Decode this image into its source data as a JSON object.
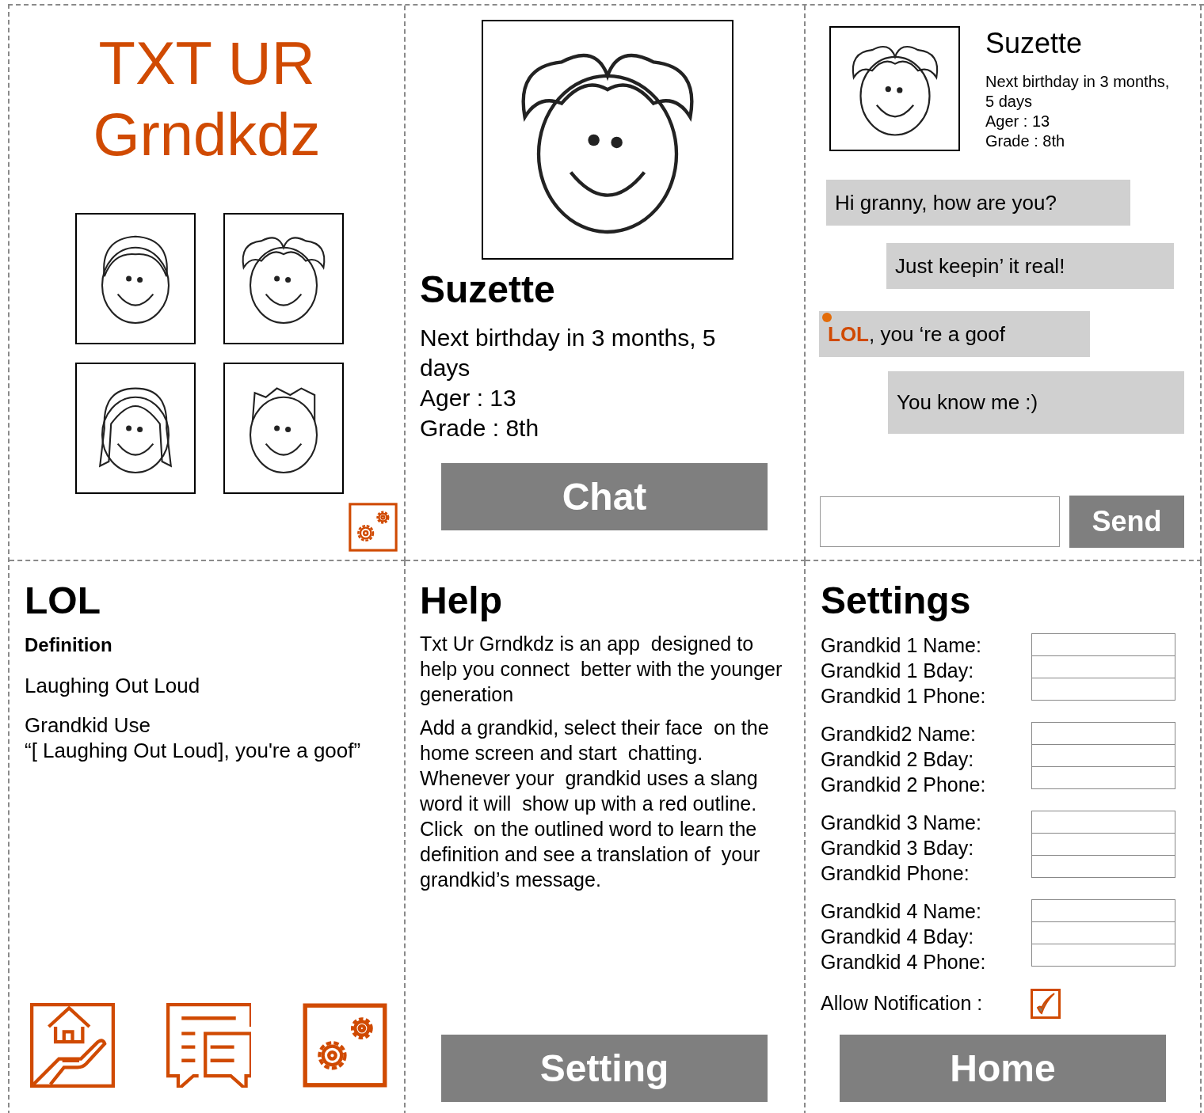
{
  "home": {
    "title_lines": [
      "TXT UR",
      "Grndkdz"
    ]
  },
  "profile": {
    "name": "Suzette",
    "details": [
      "Next birthday in 3 months, 5 days",
      "Ager  : 13",
      "Grade : 8th"
    ],
    "button": "Chat"
  },
  "chat": {
    "name": "Suzette",
    "details": [
      "Next birthday  in 3 months,",
      "5 days",
      "Ager   : 13",
      "Grade  : 8th"
    ],
    "messages": [
      {
        "text": "Hi granny, how are you?",
        "kind": "received",
        "flagged": false
      },
      {
        "text": "Just keepin’ it real!",
        "kind": "sent",
        "flagged": false
      },
      {
        "text": "**LOL**, you ‘re a goof",
        "kind": "received",
        "flagged": true
      },
      {
        "text": "You know me :)",
        "kind": "sent",
        "flagged": false
      }
    ],
    "send_button": "Send"
  },
  "lol": {
    "title": "LOL",
    "definition_heading": "Definition",
    "definition": "Laughing Out Loud",
    "use_heading": "Grandkid Use",
    "use_text": "“[ Laughing Out Loud],  you're a goof”"
  },
  "help": {
    "title": "Help",
    "paragraphs": [
      "Txt Ur Grndkdz is an app  designed to help you connect  better with the younger generation",
      "Add a grandkid, select their face  on the home screen and start  chatting. Whenever your  grandkid uses a slang word it will  show up with a red outline. Click  on the outlined word to learn the definition and see a translation of  your grandkid’s message."
    ],
    "button": "Setting"
  },
  "settings": {
    "title": "Settings",
    "groups": [
      {
        "fields": [
          "Grandkid 1 Name:",
          "Grandkid 1 Bday:",
          "Grandkid 1 Phone:"
        ]
      },
      {
        "fields": [
          "Grandkid2 Name:",
          "Grandkid 2 Bday:",
          "Grandkid 2 Phone:"
        ]
      },
      {
        "fields": [
          "Grandkid 3 Name:",
          "Grandkid 3 Bday:",
          "Grandkid Phone:"
        ]
      },
      {
        "fields": [
          "Grandkid 4 Name:",
          "Grandkid 4 Bday:",
          "Grandkid 4 Phone:"
        ]
      }
    ],
    "notification": {
      "label": "Allow Notification :",
      "checked": true
    },
    "button": "Home"
  }
}
